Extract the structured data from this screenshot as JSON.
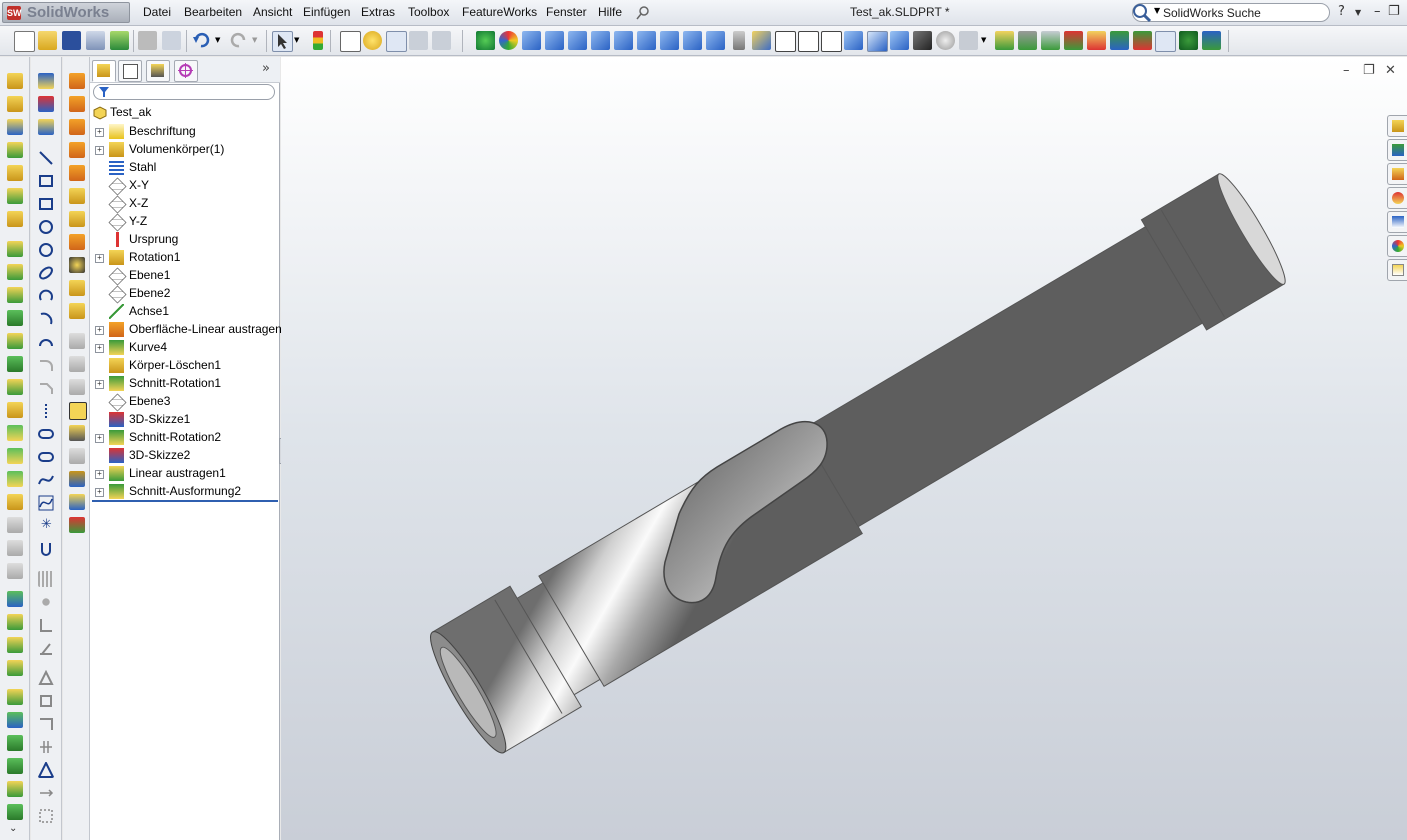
{
  "app": {
    "logo_text": "SolidWorks",
    "logo_mark": "SW"
  },
  "menu": [
    "Datei",
    "Bearbeiten",
    "Ansicht",
    "Einfügen",
    "Extras",
    "Toolbox",
    "FeatureWorks",
    "Fenster",
    "Hilfe"
  ],
  "document": {
    "title": "Test_ak.SLDPRT *"
  },
  "search": {
    "placeholder": "SolidWorks Suche"
  },
  "window_controls": {
    "help": "?",
    "minimize": "–",
    "restore": "❐",
    "close": "✕"
  },
  "viewport_controls": {
    "minimize": "–",
    "restore": "❐",
    "close": "✕"
  },
  "feature_tree": {
    "root": "Test_ak",
    "expand_glyph": "+",
    "items": [
      {
        "label": "Beschriftung",
        "icon": "annotation-icon",
        "expandable": true
      },
      {
        "label": "Volumenkörper(1)",
        "icon": "solid-bodies-icon",
        "expandable": true
      },
      {
        "label": "Stahl",
        "icon": "material-icon",
        "expandable": false
      },
      {
        "label": "X-Y",
        "icon": "plane-icon",
        "expandable": false
      },
      {
        "label": "X-Z",
        "icon": "plane-icon",
        "expandable": false
      },
      {
        "label": "Y-Z",
        "icon": "plane-icon",
        "expandable": false
      },
      {
        "label": "Ursprung",
        "icon": "origin-icon",
        "expandable": false
      },
      {
        "label": "Rotation1",
        "icon": "revolve-icon",
        "expandable": true
      },
      {
        "label": "Ebene1",
        "icon": "plane-icon",
        "expandable": false
      },
      {
        "label": "Ebene2",
        "icon": "plane-icon",
        "expandable": false
      },
      {
        "label": "Achse1",
        "icon": "axis-icon",
        "expandable": false
      },
      {
        "label": "Oberfläche-Linear austragen1",
        "icon": "surface-extrude-icon",
        "expandable": true
      },
      {
        "label": "Kurve4",
        "icon": "curve-icon",
        "expandable": true
      },
      {
        "label": "Körper-Löschen1",
        "icon": "delete-body-icon",
        "expandable": false
      },
      {
        "label": "Schnitt-Rotation1",
        "icon": "cut-revolve-icon",
        "expandable": true
      },
      {
        "label": "Ebene3",
        "icon": "plane-icon",
        "expandable": false
      },
      {
        "label": "3D-Skizze1",
        "icon": "3d-sketch-icon",
        "expandable": false
      },
      {
        "label": "Schnitt-Rotation2",
        "icon": "cut-revolve-icon",
        "expandable": true
      },
      {
        "label": "3D-Skizze2",
        "icon": "3d-sketch-icon",
        "expandable": false
      },
      {
        "label": "Linear austragen1",
        "icon": "extrude-icon",
        "expandable": true
      },
      {
        "label": "Schnitt-Ausformung2",
        "icon": "cut-loft-icon",
        "expandable": true
      }
    ]
  },
  "colors": {
    "accent": "#2f5fb0",
    "icon_yellow": "#e8c21c",
    "icon_green": "#3aa13a",
    "icon_blue": "#2f6fc8",
    "part_gray": "#9a9a9a"
  }
}
